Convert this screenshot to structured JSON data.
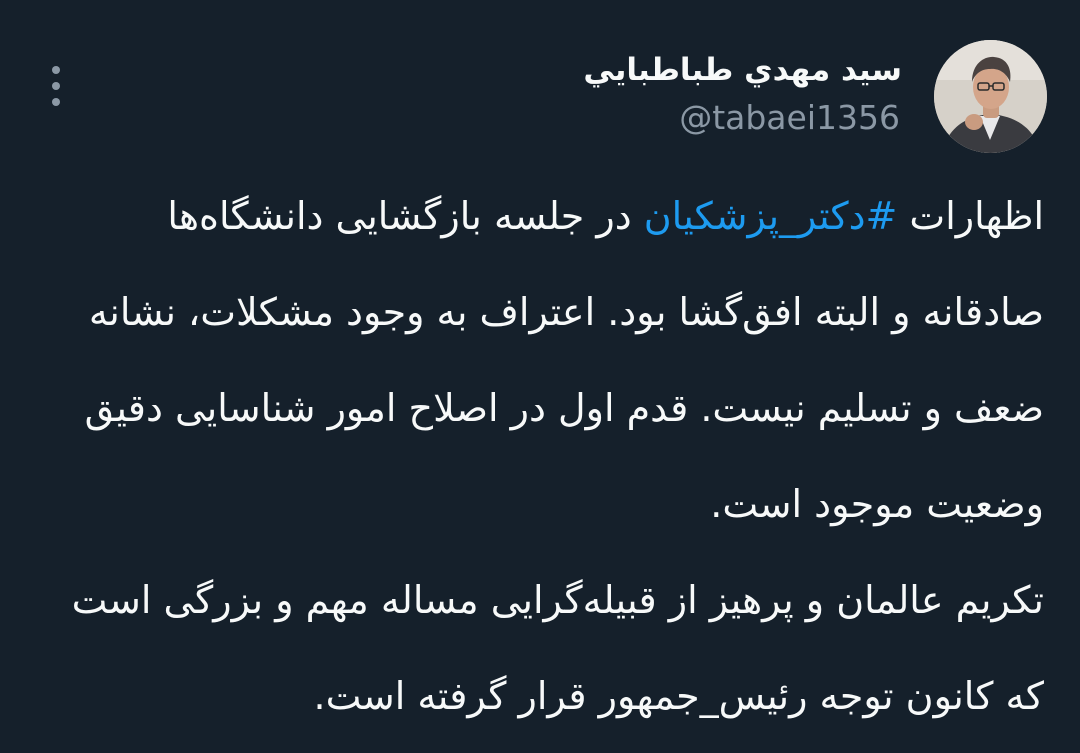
{
  "author": {
    "name": "سيد مهدي طباطبايي",
    "handle": "@tabaei1356",
    "avatar_icon": "profile-photo"
  },
  "more_icon": "more-vertical-icon",
  "colors": {
    "background": "#15202b",
    "text": "#f7f9f9",
    "secondary": "#8b98a5",
    "link": "#1d9bf0"
  },
  "tweet": {
    "p1_before": "اظهارات ",
    "hashtag": "#دکتر_پزشکیان",
    "p1_after": " در جلسه بازگشایی دانشگاه‌ها صادقانه و البته افق‌گشا بود. اعتراف به وجود مشکلات، نشانه ضعف و تسلیم نیست. قدم اول در اصلاح امور شناسایی دقیق وضعیت موجود است.",
    "p2": "تکریم عالمان و پرهیز از قبیله‌گرایی مساله مهم و بزرگی است که کانون توجه رئیس_جمهور قرار گرفته است."
  }
}
